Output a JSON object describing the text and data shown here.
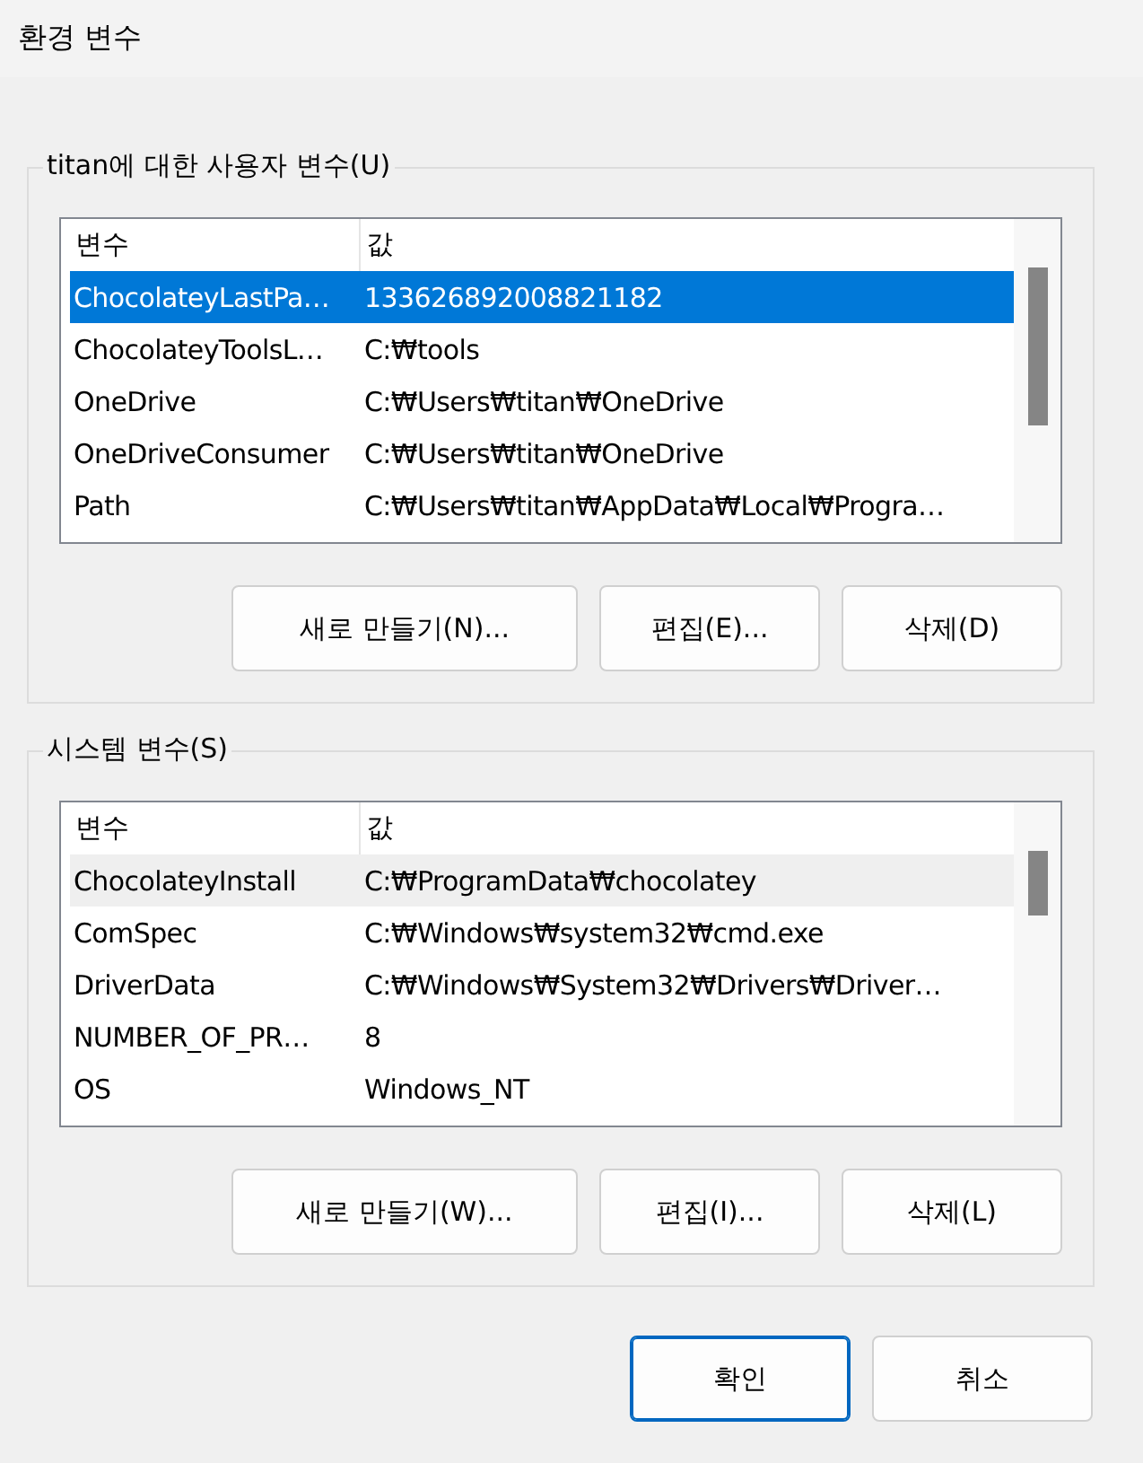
{
  "window": {
    "title": "환경 변수"
  },
  "groups": [
    {
      "title": "titan에 대한 사용자 변수(U)",
      "columns": [
        "변수",
        "값"
      ],
      "rows": [
        {
          "name": "ChocolateyLastPa…",
          "value": "133626892008821182",
          "selected": true,
          "hovered": false
        },
        {
          "name": "ChocolateyToolsL…",
          "value": "C:₩tools",
          "selected": false,
          "hovered": false
        },
        {
          "name": "OneDrive",
          "value": "C:₩Users₩titan₩OneDrive",
          "selected": false,
          "hovered": false
        },
        {
          "name": "OneDriveConsumer",
          "value": "C:₩Users₩titan₩OneDrive",
          "selected": false,
          "hovered": false
        },
        {
          "name": "Path",
          "value": "C:₩Users₩titan₩AppData₩Local₩Progra…",
          "selected": false,
          "hovered": false
        }
      ],
      "buttons": [
        "새로 만들기(N)...",
        "편집(E)...",
        "삭제(D)"
      ]
    },
    {
      "title": "시스템 변수(S)",
      "columns": [
        "변수",
        "값"
      ],
      "rows": [
        {
          "name": "ChocolateyInstall",
          "value": "C:₩ProgramData₩chocolatey",
          "selected": false,
          "hovered": true
        },
        {
          "name": "ComSpec",
          "value": "C:₩Windows₩system32₩cmd.exe",
          "selected": false,
          "hovered": false
        },
        {
          "name": "DriverData",
          "value": "C:₩Windows₩System32₩Drivers₩Driver…",
          "selected": false,
          "hovered": false
        },
        {
          "name": "NUMBER_OF_PR…",
          "value": "8",
          "selected": false,
          "hovered": false
        },
        {
          "name": "OS",
          "value": "Windows_NT",
          "selected": false,
          "hovered": false
        }
      ],
      "buttons": [
        "새로 만들기(W)...",
        "편집(I)...",
        "삭제(L)"
      ]
    }
  ],
  "footer_buttons": [
    {
      "label": "확인",
      "kind": "default"
    },
    {
      "label": "취소",
      "kind": "normal"
    }
  ]
}
